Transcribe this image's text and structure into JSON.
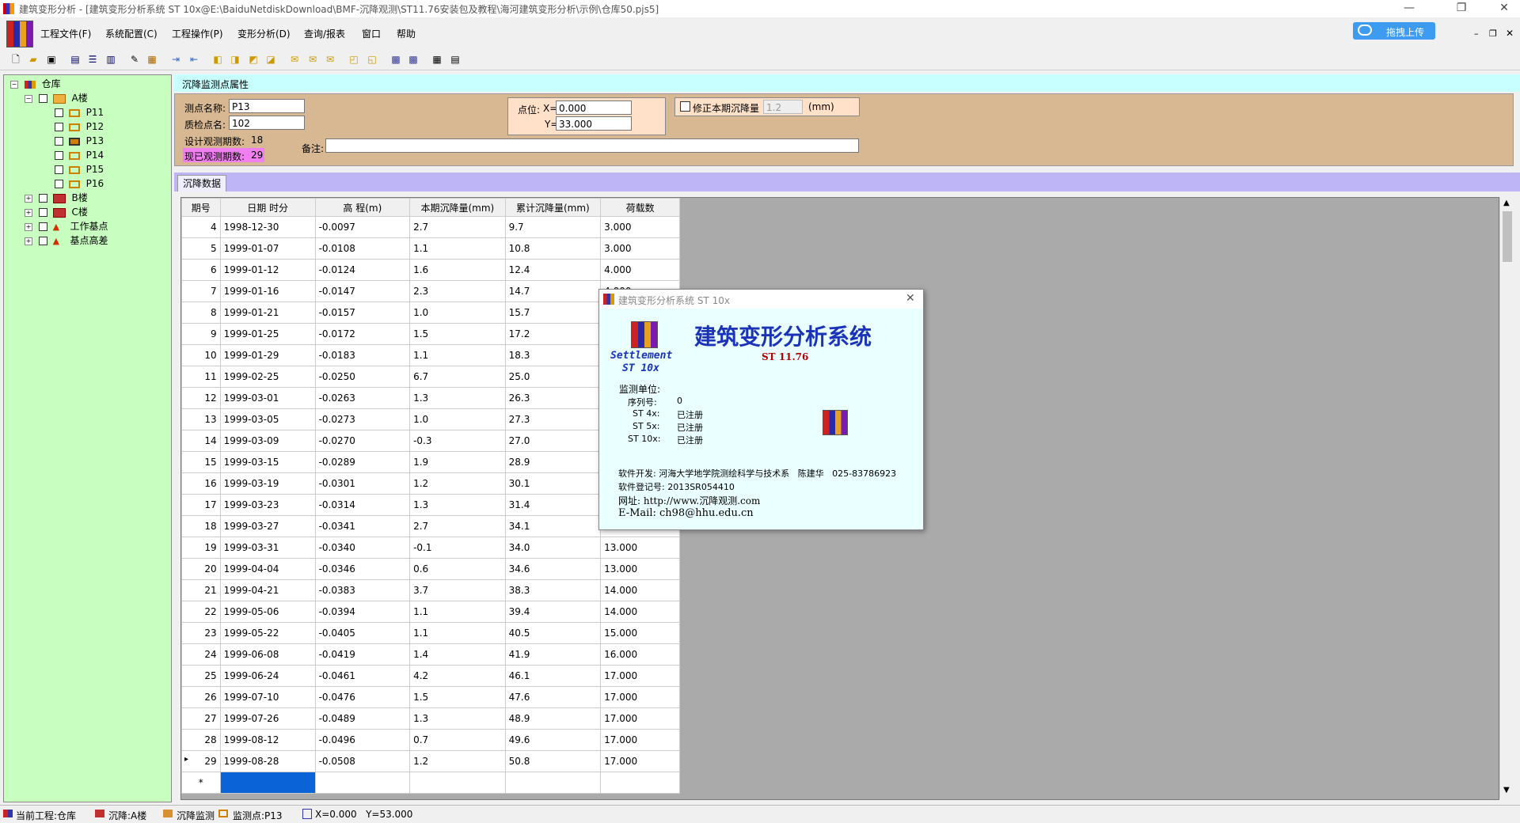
{
  "window": {
    "title": "建筑变形分析 - [建筑变形分析系统 ST 10x@E:\\BaiduNetdiskDownload\\BMF-沉降观测\\ST11.76安装包及教程\\海河建筑变形分析\\示例\\仓库50.pjs5]",
    "upload_button": "拖拽上传"
  },
  "menu": [
    "工程文件(F)",
    "系统配置(C)",
    "工程操作(P)",
    "变形分析(D)",
    "查询/报表",
    "窗口",
    "帮助"
  ],
  "tree": {
    "root": "仓库",
    "building_a": "A楼",
    "points": [
      "P11",
      "P12",
      "P13",
      "P14",
      "P15",
      "P16"
    ],
    "building_b": "B楼",
    "building_c": "C楼",
    "work_base": "工作基点",
    "base_diff": "基点高差"
  },
  "props": {
    "tab_label": "沉降监测点属性",
    "point_name_label": "测点名称:",
    "point_name": "P13",
    "check_point_label": "质检点名:",
    "check_point": "102",
    "design_periods_label": "设计观测期数:",
    "design_periods": "18",
    "current_periods_label": "现已观测期数:",
    "current_periods": "29",
    "position_label": "点位:",
    "x_label": "X=",
    "x_value": "0.000",
    "y_label": "Y=",
    "y_value": "33.000",
    "correct_label": "修正本期沉降量",
    "correct_value": "1.2",
    "correct_unit": "(mm)",
    "remark_label": "备注:",
    "remark_value": ""
  },
  "data_tab": "沉降数据",
  "table": {
    "headers": [
      "期号",
      "日期 时分",
      "高 程(m)",
      "本期沉降量(mm)",
      "累计沉降量(mm)",
      "荷载数"
    ],
    "rows": [
      [
        "4",
        "1998-12-30",
        "-0.0097",
        "2.7",
        "9.7",
        "3.000"
      ],
      [
        "5",
        "1999-01-07",
        "-0.0108",
        "1.1",
        "10.8",
        "3.000"
      ],
      [
        "6",
        "1999-01-12",
        "-0.0124",
        "1.6",
        "12.4",
        "4.000"
      ],
      [
        "7",
        "1999-01-16",
        "-0.0147",
        "2.3",
        "14.7",
        "4.000"
      ],
      [
        "8",
        "1999-01-21",
        "-0.0157",
        "1.0",
        "15.7",
        ""
      ],
      [
        "9",
        "1999-01-25",
        "-0.0172",
        "1.5",
        "17.2",
        ""
      ],
      [
        "10",
        "1999-01-29",
        "-0.0183",
        "1.1",
        "18.3",
        ""
      ],
      [
        "11",
        "1999-02-25",
        "-0.0250",
        "6.7",
        "25.0",
        ""
      ],
      [
        "12",
        "1999-03-01",
        "-0.0263",
        "1.3",
        "26.3",
        ""
      ],
      [
        "13",
        "1999-03-05",
        "-0.0273",
        "1.0",
        "27.3",
        ""
      ],
      [
        "14",
        "1999-03-09",
        "-0.0270",
        "-0.3",
        "27.0",
        ""
      ],
      [
        "15",
        "1999-03-15",
        "-0.0289",
        "1.9",
        "28.9",
        ""
      ],
      [
        "16",
        "1999-03-19",
        "-0.0301",
        "1.2",
        "30.1",
        ""
      ],
      [
        "17",
        "1999-03-23",
        "-0.0314",
        "1.3",
        "31.4",
        ""
      ],
      [
        "18",
        "1999-03-27",
        "-0.0341",
        "2.7",
        "34.1",
        ""
      ],
      [
        "19",
        "1999-03-31",
        "-0.0340",
        "-0.1",
        "34.0",
        "13.000"
      ],
      [
        "20",
        "1999-04-04",
        "-0.0346",
        "0.6",
        "34.6",
        "13.000"
      ],
      [
        "21",
        "1999-04-21",
        "-0.0383",
        "3.7",
        "38.3",
        "14.000"
      ],
      [
        "22",
        "1999-05-06",
        "-0.0394",
        "1.1",
        "39.4",
        "14.000"
      ],
      [
        "23",
        "1999-05-22",
        "-0.0405",
        "1.1",
        "40.5",
        "15.000"
      ],
      [
        "24",
        "1999-06-08",
        "-0.0419",
        "1.4",
        "41.9",
        "16.000"
      ],
      [
        "25",
        "1999-06-24",
        "-0.0461",
        "4.2",
        "46.1",
        "17.000"
      ],
      [
        "26",
        "1999-07-10",
        "-0.0476",
        "1.5",
        "47.6",
        "17.000"
      ],
      [
        "27",
        "1999-07-26",
        "-0.0489",
        "1.3",
        "48.9",
        "17.000"
      ],
      [
        "28",
        "1999-08-12",
        "-0.0496",
        "0.7",
        "49.6",
        "17.000"
      ],
      [
        "29",
        "1999-08-28",
        "-0.0508",
        "1.2",
        "50.8",
        "17.000"
      ]
    ],
    "new_row_marker": "*"
  },
  "dialog": {
    "title": "建筑变形分析系统 ST 10x",
    "app_name": "建筑变形分析系统",
    "version": "ST 11.76",
    "logo_text": "Settlement",
    "logo_sub": "ST 10x",
    "unit_label": "监测单位:",
    "serial_label": "序列号:",
    "serial": "0",
    "st4_label": "ST 4x:",
    "st4": "已注册",
    "st5_label": "ST 5x:",
    "st5": "已注册",
    "st10_label": "ST 10x:",
    "st10": "已注册",
    "dev_line": "软件开发: 河海大学地学院测绘科学与技术系   陈建华   025-83786923",
    "reg_line": "软件登记号: 2013SR054410",
    "web_line": "网址: http://www.沉降观测.com",
    "email_line": "E-Mail: ch98@hhu.edu.cn"
  },
  "status": {
    "project": "当前工程:仓库",
    "building": "沉降:A楼",
    "monitor": "沉降监测",
    "point": "监测点:P13",
    "coords": "X=0.000   Y=53.000"
  },
  "colors": {
    "tree_bg": "#c8ffc0",
    "props_bg": "#d8b893",
    "dialog_bg": "#eaffff",
    "title_blue": "#1a33b8",
    "version_red": "#b00000"
  }
}
